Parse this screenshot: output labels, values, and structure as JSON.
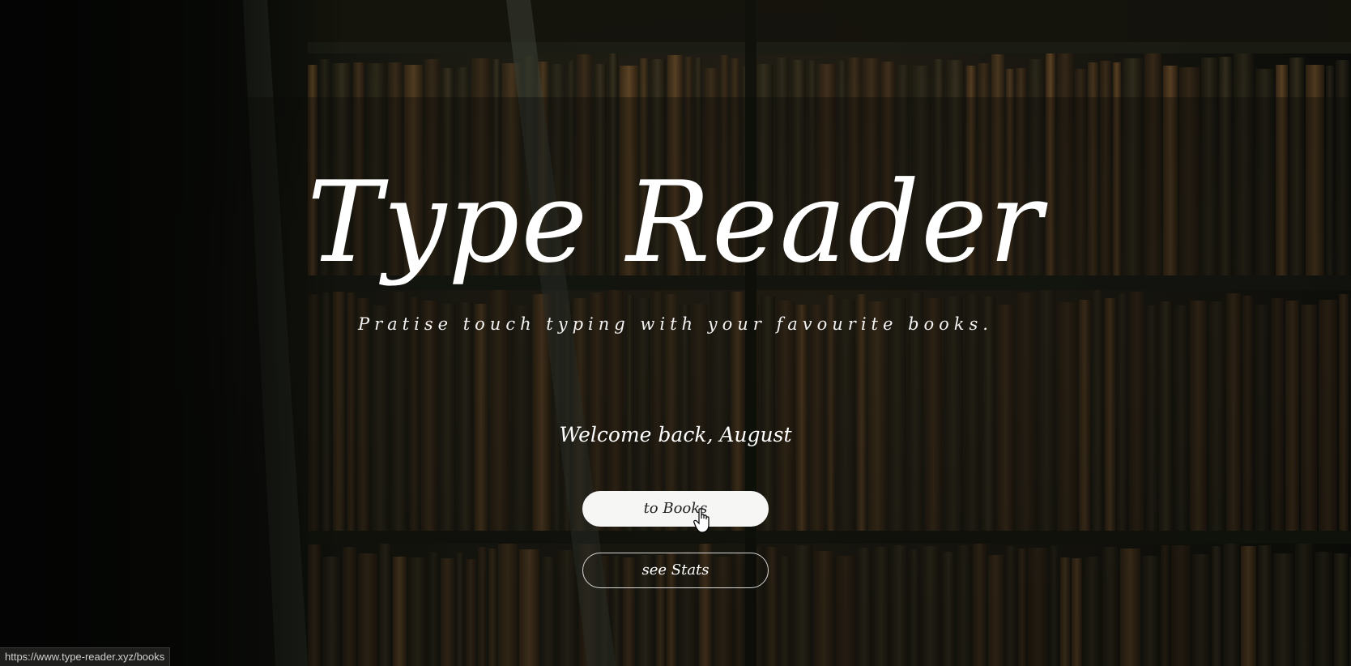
{
  "hero": {
    "title": "Type Reader",
    "subtitle": "Pratise touch typing with your favourite books.",
    "welcome": "Welcome back, August"
  },
  "actions": {
    "books_label": "to Books",
    "stats_label": "see Stats"
  },
  "statusbar": {
    "url": "https://www.type-reader.xyz/books"
  },
  "icons": {
    "cursor": "hand-pointer-icon"
  }
}
